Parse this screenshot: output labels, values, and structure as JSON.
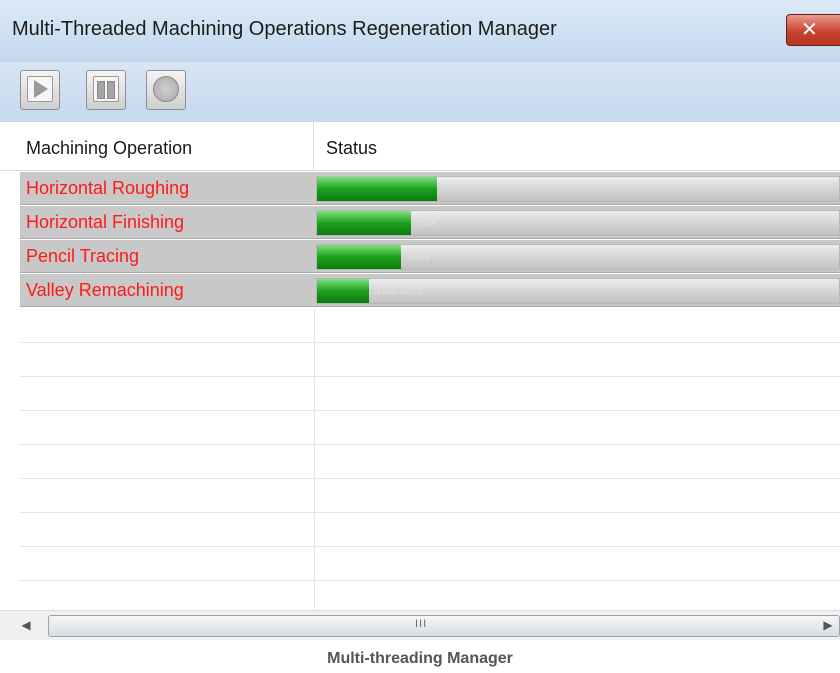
{
  "window": {
    "title": "Multi-Threaded Machining Operations Regeneration Manager"
  },
  "toolbar": {
    "buttons": [
      {
        "name": "play",
        "icon": "play-icon"
      },
      {
        "name": "pause",
        "icon": "pause-icon"
      },
      {
        "name": "stop",
        "icon": "stop-icon"
      }
    ]
  },
  "table": {
    "columns": [
      "Machining Operation",
      "Status"
    ],
    "rows": [
      {
        "operation": "Horizontal Roughing",
        "progress": 0.23,
        "status_text": ""
      },
      {
        "operation": "Horizontal Finishing",
        "progress": 0.18,
        "status_text": "ed"
      },
      {
        "operation": "Pencil Tracing",
        "progress": 0.16,
        "status_text": "ted"
      },
      {
        "operation": "Valley Remachining",
        "progress": 0.1,
        "status_text": "started"
      }
    ]
  },
  "scrollbar": {
    "grip": "III"
  },
  "caption": "Multi-threading Manager",
  "colors": {
    "operation_text": "#ff1a1a",
    "progress_fill": "#1da11d",
    "row_highlight": "#c8c8c8",
    "titlebar": "#c4d8ee"
  }
}
